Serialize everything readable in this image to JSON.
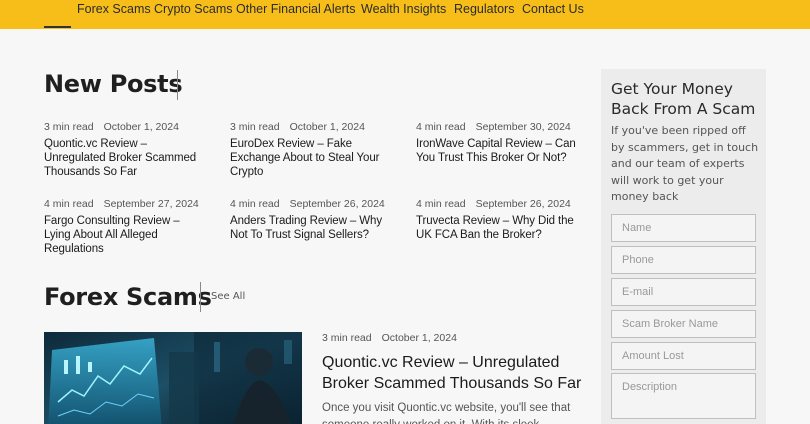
{
  "nav": {
    "items": [
      {
        "label": "Forex Scams"
      },
      {
        "label": "Crypto Scams"
      },
      {
        "label": "Other Financial Alerts"
      },
      {
        "label": "Wealth Insights"
      },
      {
        "label": "Regulators"
      },
      {
        "label": "Contact Us"
      }
    ]
  },
  "new_posts": {
    "heading": "New Posts",
    "posts": [
      {
        "read_time": "3 min read",
        "date": "October 1, 2024",
        "title": "Quontic.vc Review – Unregulated Broker Scammed Thousands So Far"
      },
      {
        "read_time": "3 min read",
        "date": "October 1, 2024",
        "title": "EuroDex Review – Fake Exchange About to Steal Your Crypto"
      },
      {
        "read_time": "4 min read",
        "date": "September 30, 2024",
        "title": "IronWave Capital Review – Can You Trust This Broker Or Not?"
      },
      {
        "read_time": "4 min read",
        "date": "September 27, 2024",
        "title": "Fargo Consulting Review – Lying About All Alleged Regulations"
      },
      {
        "read_time": "4 min read",
        "date": "September 26, 2024",
        "title": "Anders Trading Review – Why Not To Trust Signal Sellers?"
      },
      {
        "read_time": "4 min read",
        "date": "September 26, 2024",
        "title": "Truvecta Review – Why Did the UK FCA Ban the Broker?"
      }
    ]
  },
  "forex_section": {
    "heading": "Forex Scams",
    "see_all": "See All",
    "featured": {
      "read_time": "3 min read",
      "date": "October 1, 2024",
      "title": "Quontic.vc Review – Unregulated Broker Scammed Thousands So Far",
      "excerpt": "Once you visit Quontic.vc website, you'll see that someone really worked on it. With its sleek"
    }
  },
  "sidebar": {
    "title": "Get Your Money Back From A Scam",
    "text": "If you've been ripped off by scammers, get in touch and our team of experts will work to get your money back",
    "fields": [
      {
        "placeholder": "Name"
      },
      {
        "placeholder": "Phone"
      },
      {
        "placeholder": "E-mail"
      },
      {
        "placeholder": "Scam Broker Name"
      },
      {
        "placeholder": "Amount Lost"
      },
      {
        "placeholder": "Description"
      }
    ]
  },
  "colors": {
    "accent": "#f7be1a",
    "sidebar_bg": "#ececec",
    "page_bg": "#f7f7f7"
  }
}
